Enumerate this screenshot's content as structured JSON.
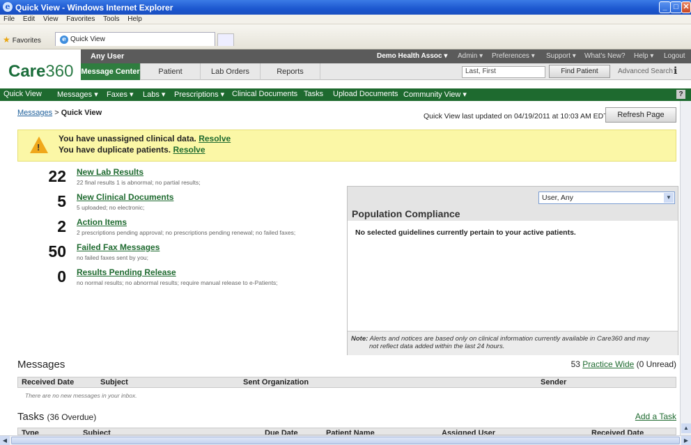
{
  "window": {
    "title": "Quick View - Windows Internet Explorer"
  },
  "menu": [
    "File",
    "Edit",
    "View",
    "Favorites",
    "Tools",
    "Help"
  ],
  "favorites": {
    "label": "Favorites",
    "tab": "Quick View"
  },
  "app": {
    "logo_bold": "Care",
    "logo_thin": "360",
    "user": "Any User",
    "org": "Demo Health Assoc",
    "top_links": [
      "Admin",
      "Preferences",
      "Support",
      "What's New?",
      "Help",
      "Logout"
    ],
    "tabs": [
      "Message Center",
      "Patient",
      "Lab Orders",
      "Reports"
    ],
    "search_placeholder": "Last, First",
    "find_button": "Find Patient",
    "advanced_search": "Advanced Search"
  },
  "nav": [
    "Quick View",
    "Messages ▾",
    "Faxes ▾",
    "Labs ▾",
    "Prescriptions ▾",
    "Clinical Documents",
    "Tasks",
    "Upload Documents",
    "Community View ▾"
  ],
  "breadcrumb": {
    "link": "Messages",
    "sep": " > ",
    "current": "Quick View"
  },
  "updated": "Quick View last updated on 04/19/2011 at 10:03 AM EDT.",
  "refresh": "Refresh Page",
  "alert": {
    "line1": "You have unassigned clinical data.",
    "line2": "You have duplicate patients.",
    "resolve": "Resolve"
  },
  "stats": [
    {
      "count": "22",
      "title": "New Lab Results",
      "sub": "22 final results 1 is abnormal; no partial results;"
    },
    {
      "count": "5",
      "title": "New Clinical Documents",
      "sub": "5 uploaded; no electronic;"
    },
    {
      "count": "2",
      "title": "Action Items",
      "sub": "2 prescriptions pending approval; no prescriptions pending renewal; no failed faxes;"
    },
    {
      "count": "50",
      "title": "Failed Fax Messages",
      "sub": "no failed faxes sent by you;"
    },
    {
      "count": "0",
      "title": "Results Pending Release",
      "sub": "no normal results; no abnormal results; require manual release to e-Patients;"
    }
  ],
  "population": {
    "select": "User, Any",
    "title": "Population Compliance",
    "body": "No selected guidelines currently pertain to your active patients.",
    "note_label": "Note:",
    "note_line1": "Alerts and notices are based only on clinical information currently available in Care360 and may",
    "note_line2": "not reflect data added within the last 24 hours."
  },
  "messages": {
    "title": "Messages",
    "count": "53",
    "practice_link": "Practice Wide",
    "unread": "(0 Unread)",
    "columns": [
      "Received Date",
      "Subject",
      "Sent Organization",
      "Sender"
    ],
    "empty": "There are no new messages in your inbox."
  },
  "tasks": {
    "title": "Tasks",
    "overdue": "(36 Overdue)",
    "add": "Add a Task",
    "columns": [
      "Type",
      "Subject",
      "Due Date",
      "Patient Name",
      "Assigned User",
      "Received Date"
    ]
  }
}
